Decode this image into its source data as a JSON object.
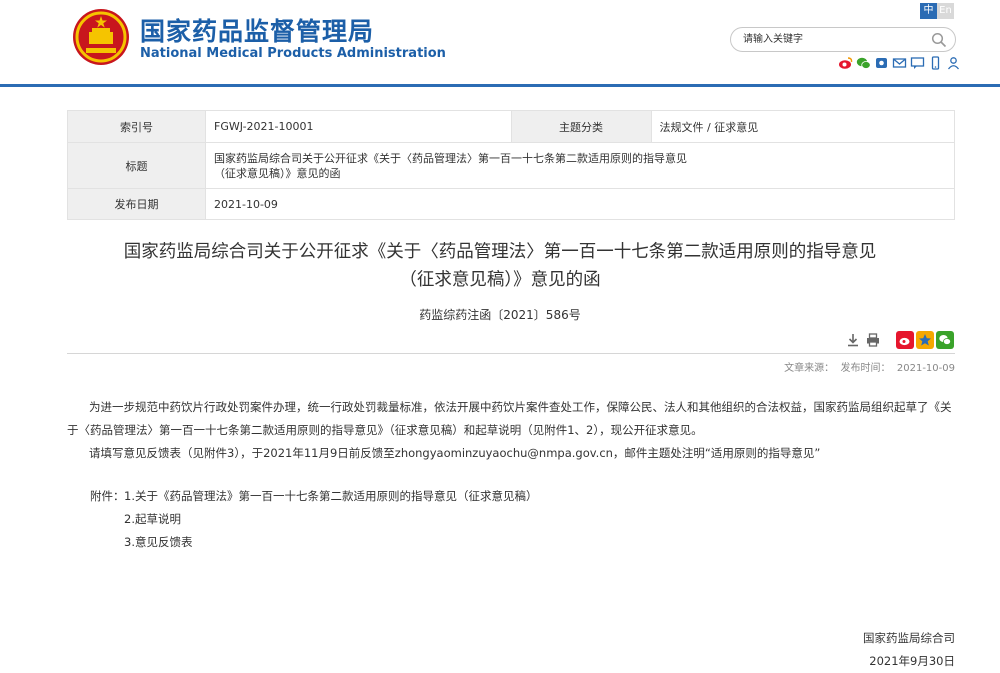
{
  "header": {
    "logo_cn": "国家药品监督管理局",
    "logo_en": "National Medical Products Administration",
    "lang_cn": "中",
    "lang_en": "En",
    "search_placeholder": "请输入关键字",
    "social_icons": [
      "weibo-icon",
      "wechat-icon",
      "app-icon",
      "email-icon",
      "feedback-icon",
      "mobile-icon",
      "user-icon"
    ],
    "brand_color": "#1c5fa8",
    "accent_color": "#2b6cb4"
  },
  "meta": {
    "index_label": "索引号",
    "index_value": "FGWJ-2021-10001",
    "category_label": "主题分类",
    "category_value": "法规文件 / 征求意见",
    "title_label": "标题",
    "title_line1": "国家药监局综合司关于公开征求《关于〈药品管理法〉第一百一十七条第二款适用原则的指导意见",
    "title_line2": "（征求意见稿）》意见的函",
    "date_label": "发布日期",
    "date_value": "2021-10-09"
  },
  "article": {
    "title_line1": "国家药监局综合司关于公开征求《关于〈药品管理法〉第一百一十七条第二款适用原则的指导意见",
    "title_line2": "（征求意见稿）》意见的函",
    "doc_number": "药监综药注函〔2021〕586号",
    "source_text": "文章来源：  发布时间：  2021-10-09",
    "para1": "为进一步规范中药饮片行政处罚案件办理，统一行政处罚裁量标准，依法开展中药饮片案件查处工作，保障公民、法人和其他组织的合法权益，国家药监局组织起草了《关于〈药品管理法〉第一百一十七条第二款适用原则的指导意见》（征求意见稿）和起草说明（见附件1、2），现公开征求意见。",
    "para2": "请填写意见反馈表（见附件3），于2021年11月9日前反馈至zhongyaominzuyaochu@nmpa.gov.cn，邮件主题处注明“适用原则的指导意见”",
    "attach_label": "附件：",
    "attachments": [
      "1.关于《药品管理法》第一百一十七条第二款适用原则的指导意见（征求意见稿）",
      "2.起草说明",
      "3.意见反馈表"
    ],
    "signature": "国家药监局综合司",
    "sign_date": "2021年9月30日"
  }
}
